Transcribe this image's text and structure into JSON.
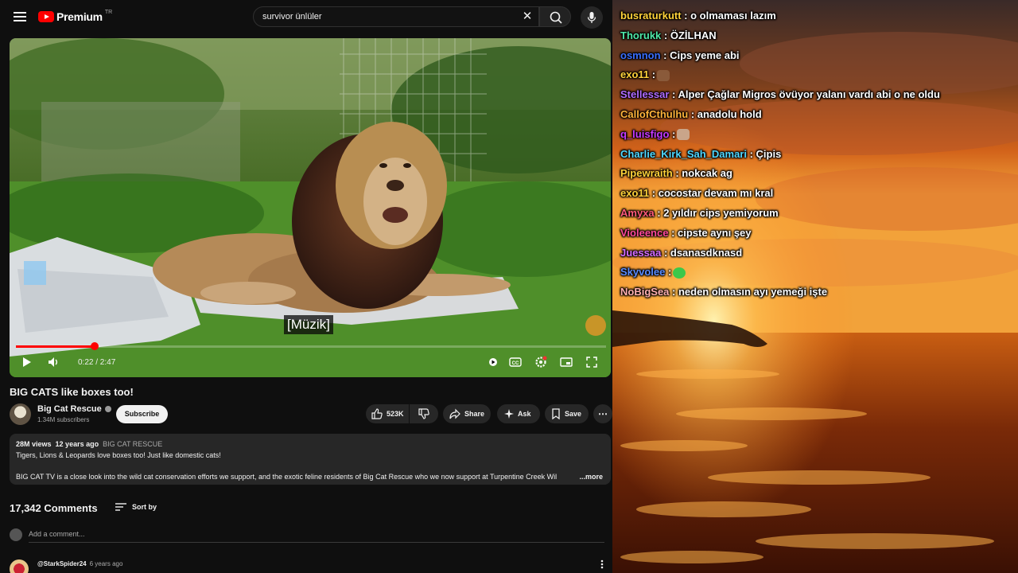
{
  "youtube": {
    "logo_text": "Premium",
    "logo_region": "TR",
    "search_value": "survivor ünlüler",
    "player": {
      "caption": "[Müzik]",
      "time": "0:22 / 2:47",
      "progress_fraction": 0.133
    },
    "video": {
      "title": "BIG CATS like boxes too!",
      "channel_name": "Big Cat Rescue",
      "subscribers": "1.34M subscribers",
      "subscribe_label": "Subscribe",
      "likes": "523K",
      "share_label": "Share",
      "ask_label": "Ask",
      "save_label": "Save"
    },
    "description": {
      "views": "28M views",
      "age": "12 years ago",
      "tag": "BIG CAT RESCUE",
      "line1": "Tigers, Lions & Leopards love boxes too! Just like domestic cats!",
      "line2": "BIG CAT TV is a close look into the wild cat conservation efforts we support, and the exotic feline residents of Big Cat Rescue who we now support at Turpentine Creek Wil",
      "more_label": "...more"
    },
    "comments": {
      "count_label": "17,342 Comments",
      "sort_label": "Sort by",
      "add_placeholder": "Add a comment...",
      "first": {
        "author": "@StarkSpider24",
        "time": "6 years ago"
      }
    }
  },
  "chat": {
    "messages": [
      {
        "user": "busraturkutt",
        "color": "#ffd23a",
        "text": ": o olmaması lazım",
        "emote": ""
      },
      {
        "user": "Thorukk",
        "color": "#4fe8a8",
        "text": ": ÖZİLHAN",
        "emote": ""
      },
      {
        "user": "osmnon",
        "color": "#3a6fff",
        "text": ": Cips yeme abi",
        "emote": ""
      },
      {
        "user": "exo11",
        "color": "#ffd23a",
        "text": ":",
        "emote": "face"
      },
      {
        "user": "Stellessar",
        "color": "#b06cff",
        "text": ": Alper Çağlar Migros övüyor yalanı vardı abi o ne oldu",
        "emote": ""
      },
      {
        "user": "CallofCthulhu",
        "color": "#ffb43a",
        "text": ": anadolu hold",
        "emote": ""
      },
      {
        "user": "q_luisfigo",
        "color": "#c63aff",
        "text": ":",
        "emote": "figure"
      },
      {
        "user": "Charlie_Kirk_Sah_Damari",
        "color": "#4fd8ff",
        "text": ": Çipis",
        "emote": ""
      },
      {
        "user": "Pipewraith",
        "color": "#ffd23a",
        "text": ": nokcak ag",
        "emote": ""
      },
      {
        "user": "exo11",
        "color": "#ffd23a",
        "text": ": cocostar devam mı kral",
        "emote": ""
      },
      {
        "user": "Amyxa",
        "color": "#ff5a7a",
        "text": ": 2 yıldır cips yemiyorum",
        "emote": ""
      },
      {
        "user": "Violeence",
        "color": "#ff4a9a",
        "text": ": cipste aynı şey",
        "emote": ""
      },
      {
        "user": "Juessaa",
        "color": "#d46cff",
        "text": ": dsanasdknasd",
        "emote": ""
      },
      {
        "user": "Skyvolee",
        "color": "#5a8cff",
        "text": ":",
        "emote": "green"
      },
      {
        "user": "NoBigSea",
        "color": "#ffb0b0",
        "text": ": neden olmasın ayı yemeği işte",
        "emote": ""
      }
    ]
  }
}
